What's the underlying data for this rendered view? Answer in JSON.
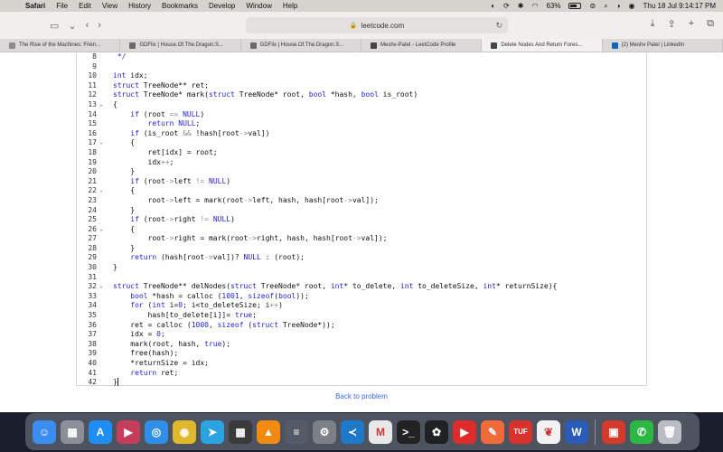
{
  "menubar": {
    "items": [
      "Safari",
      "File",
      "Edit",
      "View",
      "History",
      "Bookmarks",
      "Develop",
      "Window",
      "Help"
    ],
    "battery": "63%",
    "datetime": "Thu 18 Jul  9:14:17 PM"
  },
  "toolbar": {
    "url": "leetcode.com"
  },
  "tabs": [
    {
      "label": "The Rise of the Machines: Frien...",
      "icon": "tab-page-icon",
      "color": "#8a8a8a"
    },
    {
      "label": "GDFlix | House.Of.The.Dragon.S...",
      "icon": "gdflix-icon",
      "color": "#6a6a6a"
    },
    {
      "label": "GDFlix | House.Of.The.Dragon.S...",
      "icon": "gdflix-icon",
      "color": "#6a6a6a"
    },
    {
      "label": "Meshv-Patel - LeetCode Profile",
      "icon": "leetcode-icon",
      "color": "#444444"
    },
    {
      "label": "Delete Nodes And Return Fores...",
      "icon": "leetcode-icon",
      "color": "#444444",
      "active": true
    },
    {
      "label": "(2) Meshv Patel | LinkedIn",
      "icon": "linkedin-icon",
      "color": "#0a66c2"
    }
  ],
  "code_lines": [
    {
      "n": "8",
      "fold": "",
      "html": " <span class=\"cmt\">*/</span>"
    },
    {
      "n": "9",
      "fold": "",
      "html": ""
    },
    {
      "n": "10",
      "fold": "",
      "html": "<span class=\"kw\">int</span> idx;"
    },
    {
      "n": "11",
      "fold": "",
      "html": "<span class=\"kw\">struct</span> TreeNode** ret;"
    },
    {
      "n": "12",
      "fold": "",
      "html": "<span class=\"kw\">struct</span> TreeNode* mark(<span class=\"kw\">struct</span> TreeNode* root, <span class=\"kw\">bool</span> *hash, <span class=\"kw\">bool</span> is_root)"
    },
    {
      "n": "13",
      "fold": "v",
      "html": "{"
    },
    {
      "n": "14",
      "fold": "",
      "html": "    <span class=\"kw\">if</span> (root <span class=\"op\">==</span> <span class=\"kw\">NULL</span>)"
    },
    {
      "n": "15",
      "fold": "",
      "html": "        <span class=\"kw\">return</span> <span class=\"kw\">NULL</span>;"
    },
    {
      "n": "16",
      "fold": "",
      "html": "    <span class=\"kw\">if</span> (is_root <span class=\"op\">&amp;&amp;</span> !hash[root<span class=\"op\">-&gt;</span>val])"
    },
    {
      "n": "17",
      "fold": "v",
      "html": "    {"
    },
    {
      "n": "18",
      "fold": "",
      "html": "        ret[idx] = root;"
    },
    {
      "n": "19",
      "fold": "",
      "html": "        idx<span class=\"op\">++</span>;"
    },
    {
      "n": "20",
      "fold": "",
      "html": "    }"
    },
    {
      "n": "21",
      "fold": "",
      "html": "    <span class=\"kw\">if</span> (root<span class=\"op\">-&gt;</span>left <span class=\"op\">!=</span> <span class=\"kw\">NULL</span>)"
    },
    {
      "n": "22",
      "fold": "v",
      "html": "    {"
    },
    {
      "n": "23",
      "fold": "",
      "html": "        root<span class=\"op\">-&gt;</span>left = mark(root<span class=\"op\">-&gt;</span>left, hash, hash[root<span class=\"op\">-&gt;</span>val]);"
    },
    {
      "n": "24",
      "fold": "",
      "html": "    }"
    },
    {
      "n": "25",
      "fold": "",
      "html": "    <span class=\"kw\">if</span> (root<span class=\"op\">-&gt;</span>right <span class=\"op\">!=</span> <span class=\"kw\">NULL</span>)"
    },
    {
      "n": "26",
      "fold": "v",
      "html": "    {"
    },
    {
      "n": "27",
      "fold": "",
      "html": "        root<span class=\"op\">-&gt;</span>right = mark(root<span class=\"op\">-&gt;</span>right, hash, hash[root<span class=\"op\">-&gt;</span>val]);"
    },
    {
      "n": "28",
      "fold": "",
      "html": "    }"
    },
    {
      "n": "29",
      "fold": "",
      "html": "    <span class=\"kw\">return</span> (hash[root<span class=\"op\">-&gt;</span>val])? <span class=\"kw\">NULL</span> : (root);"
    },
    {
      "n": "30",
      "fold": "",
      "html": "}"
    },
    {
      "n": "31",
      "fold": "",
      "html": ""
    },
    {
      "n": "32",
      "fold": "v",
      "html": "<span class=\"kw\">struct</span> TreeNode** delNodes(<span class=\"kw\">struct</span> TreeNode* root, <span class=\"kw\">int</span>* to_delete, <span class=\"kw\">int</span> to_deleteSize, <span class=\"kw\">int</span>* returnSize){"
    },
    {
      "n": "33",
      "fold": "",
      "html": "    <span class=\"kw\">bool</span> *hash = calloc (<span class=\"num\">1001</span>, <span class=\"kw\">sizeof</span>(<span class=\"kw\">bool</span>));"
    },
    {
      "n": "34",
      "fold": "",
      "html": "    <span class=\"kw\">for</span> (<span class=\"kw\">int</span> i=<span class=\"num\">0</span>; i&lt;to_deleteSize; i<span class=\"op\">++</span>)"
    },
    {
      "n": "35",
      "fold": "",
      "html": "        hash[to_delete[i]]= <span class=\"kw\">true</span>;"
    },
    {
      "n": "36",
      "fold": "",
      "html": "    ret = calloc (<span class=\"num\">1000</span>, <span class=\"kw\">sizeof</span> (<span class=\"kw\">struct</span> TreeNode*));"
    },
    {
      "n": "37",
      "fold": "",
      "html": "    idx = <span class=\"num\">0</span>;"
    },
    {
      "n": "38",
      "fold": "",
      "html": "    mark(root, hash, <span class=\"kw\">true</span>);"
    },
    {
      "n": "39",
      "fold": "",
      "html": "    free(hash);"
    },
    {
      "n": "40",
      "fold": "",
      "html": "    *returnSize = idx;"
    },
    {
      "n": "41",
      "fold": "",
      "html": "    <span class=\"kw\">return</span> ret;"
    },
    {
      "n": "42",
      "fold": "",
      "html": "}",
      "cursor": true
    }
  ],
  "back_link": "Back to problem",
  "dock": [
    {
      "name": "finder-icon",
      "color": "#3b8df0",
      "glyph": "☺"
    },
    {
      "name": "launchpad-icon",
      "color": "#8a8f99",
      "glyph": "▦"
    },
    {
      "name": "app-store-icon",
      "color": "#1e8df5",
      "glyph": "A"
    },
    {
      "name": "clips-icon",
      "color": "#c53d5a",
      "glyph": "▶"
    },
    {
      "name": "safari-icon",
      "color": "#2f8fe8",
      "glyph": "◎"
    },
    {
      "name": "chrome-icon",
      "color": "#e0b82c",
      "glyph": "◉"
    },
    {
      "name": "telegram-icon",
      "color": "#2aa3e0",
      "glyph": "➤"
    },
    {
      "name": "calculator-icon",
      "color": "#3a3a3a",
      "glyph": "▦"
    },
    {
      "name": "vlc-icon",
      "color": "#f08a10",
      "glyph": "▲"
    },
    {
      "name": "scripts-icon",
      "color": "#555b66",
      "glyph": "≡"
    },
    {
      "name": "system-settings-icon",
      "color": "#7c7f86",
      "glyph": "⚙"
    },
    {
      "name": "vscode-icon",
      "color": "#1f79c9",
      "glyph": "≺"
    },
    {
      "name": "gmail-icon",
      "color": "#e8e8e8",
      "glyph": "M"
    },
    {
      "name": "terminal-icon",
      "color": "#222222",
      "glyph": ">_"
    },
    {
      "name": "chatgpt-icon",
      "color": "#202123",
      "glyph": "✿"
    },
    {
      "name": "youtube-icon",
      "color": "#e02b2b",
      "glyph": "▶"
    },
    {
      "name": "pen-tool-icon",
      "color": "#f06a3a",
      "glyph": "✎"
    },
    {
      "name": "tuf-icon",
      "color": "#d8322e",
      "glyph": "TUF"
    },
    {
      "name": "mongodb-icon",
      "color": "#f2f2f2",
      "glyph": "❦"
    },
    {
      "name": "word-icon",
      "color": "#2b5bb8",
      "glyph": "W"
    },
    {
      "name": "presentation-icon",
      "color": "#d23a2a",
      "glyph": "▣"
    },
    {
      "name": "whatsapp-icon",
      "color": "#2bb741",
      "glyph": "✆"
    },
    {
      "name": "trash-icon",
      "color": "#b9bcc2",
      "glyph": "🗑"
    }
  ]
}
